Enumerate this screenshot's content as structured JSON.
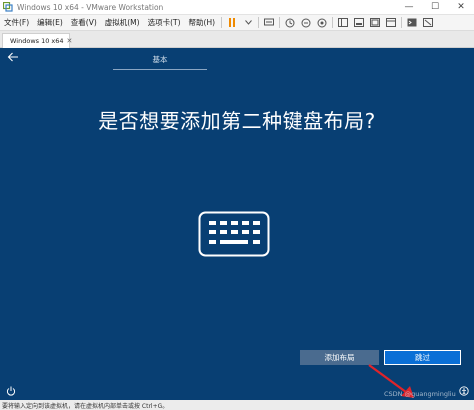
{
  "window": {
    "title": "Windows 10 x64 - VMware Workstation",
    "controls": {
      "minimize": "—",
      "maximize": "☐",
      "close": "✕"
    }
  },
  "menubar": {
    "items": [
      "文件(F)",
      "编辑(E)",
      "查看(V)",
      "虚拟机(M)",
      "选项卡(T)",
      "帮助(H)"
    ]
  },
  "tab": {
    "label": "Windows 10 x64",
    "close": "✕"
  },
  "oobe": {
    "section_tab": "基本",
    "question": "是否想要添加第二种键盘布局?",
    "add_layout_label": "添加布局",
    "skip_label": "跳过"
  },
  "watermark": "CSDN @guangmingliu",
  "status": {
    "text": "要将输入定向到该虚拟机，请在虚拟机内部单击或按 Ctrl+G。"
  },
  "colors": {
    "oobe_background": "#083f73",
    "skip_button": "#0a6fd6",
    "add_button": "#4a6b8f",
    "annotation_arrow": "#e0242a",
    "pause_orange": "#f08a00"
  },
  "icons": [
    "vmware-app-icon",
    "pause-icon",
    "dropdown-icon",
    "send-keys-icon",
    "snapshot-icon",
    "revert-snapshot-icon",
    "snapshot-manager-icon",
    "sidebar-icon",
    "thumbnail-icon",
    "fullscreen-icon",
    "unity-icon",
    "console-icon",
    "stretch-icon",
    "back-arrow-icon",
    "keyboard-icon",
    "power-icon",
    "accessibility-icon"
  ]
}
